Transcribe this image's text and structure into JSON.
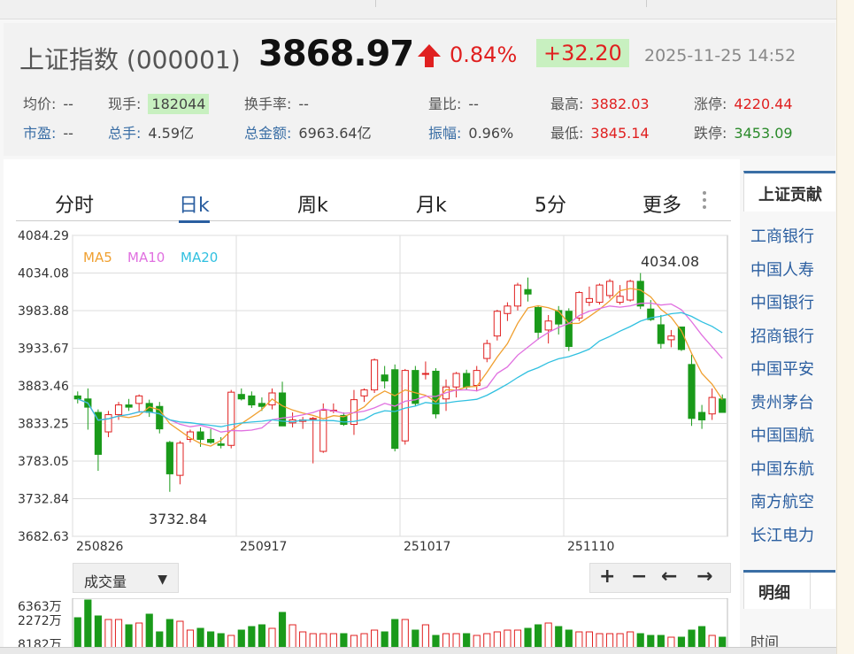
{
  "quote": {
    "name": "上证指数 (000001)",
    "price": "3868.97",
    "change_pct": "0.84%",
    "change": "+32.20",
    "time": "2025-11-25 14:52",
    "colors": {
      "up": "#e02020",
      "down": "#1a9a1a",
      "highlight_bg": "#c8f0c0"
    }
  },
  "stats": {
    "avg_label": "均价:",
    "avg_value": "--",
    "cur_label": "现手:",
    "cur_value": "182044",
    "turnover_label": "换手率:",
    "turnover_value": "--",
    "volratio_label": "量比:",
    "volratio_value": "--",
    "high_label": "最高:",
    "high_value": "3882.03",
    "limitup_label": "涨停:",
    "limitup_value": "4220.44",
    "pe_label": "市盈:",
    "pe_value": "--",
    "totalvol_label": "总手:",
    "totalvol_value": "4.59亿",
    "amount_label": "总金额:",
    "amount_value": "6963.64亿",
    "amp_label": "振幅:",
    "amp_value": "0.96%",
    "low_label": "最低:",
    "low_value": "3845.14",
    "limitdown_label": "跌停:",
    "limitdown_value": "3453.09"
  },
  "tabs": [
    {
      "label": "分时"
    },
    {
      "label": "日k"
    },
    {
      "label": "周k"
    },
    {
      "label": "月k"
    },
    {
      "label": "5分"
    },
    {
      "label": "更多"
    }
  ],
  "active_tab": "日k",
  "legend": {
    "ma5": "MA5",
    "ma10": "MA10",
    "ma20": "MA20",
    "ma5_color": "#f0a030",
    "ma10_color": "#e070e0",
    "ma20_color": "#30c0e0"
  },
  "chart_data": {
    "type": "candlestick",
    "y_ticks": [
      "4084.29",
      "4034.08",
      "3983.88",
      "3933.67",
      "3883.46",
      "3833.25",
      "3783.05",
      "3732.84",
      "3682.63"
    ],
    "ylim": [
      3682.63,
      4084.29
    ],
    "x_ticks": [
      {
        "label": "250826",
        "index": 0
      },
      {
        "label": "250917",
        "index": 16
      },
      {
        "label": "251017",
        "index": 32
      },
      {
        "label": "251110",
        "index": 48
      }
    ],
    "annotations": {
      "high": "4034.08",
      "low": "3732.84"
    },
    "candles": [
      [
        3870,
        3876,
        3860,
        3866
      ],
      [
        3866,
        3880,
        3825,
        3855
      ],
      [
        3848,
        3852,
        3770,
        3792
      ],
      [
        3822,
        3850,
        3815,
        3845
      ],
      [
        3845,
        3862,
        3838,
        3858
      ],
      [
        3858,
        3866,
        3850,
        3855
      ],
      [
        3860,
        3872,
        3848,
        3870
      ],
      [
        3860,
        3865,
        3842,
        3848
      ],
      [
        3856,
        3862,
        3820,
        3826
      ],
      [
        3808,
        3810,
        3742,
        3766
      ],
      [
        3764,
        3810,
        3752,
        3807
      ],
      [
        3812,
        3825,
        3808,
        3822
      ],
      [
        3822,
        3828,
        3802,
        3812
      ],
      [
        3812,
        3826,
        3806,
        3808
      ],
      [
        3806,
        3815,
        3800,
        3804
      ],
      [
        3804,
        3878,
        3800,
        3875
      ],
      [
        3872,
        3880,
        3864,
        3866
      ],
      [
        3870,
        3876,
        3854,
        3858
      ],
      [
        3860,
        3868,
        3850,
        3856
      ],
      [
        3858,
        3880,
        3852,
        3874
      ],
      [
        3874,
        3889,
        3830,
        3830
      ],
      [
        3834,
        3848,
        3828,
        3838
      ],
      [
        3836,
        3842,
        3826,
        3838
      ],
      [
        3839,
        3842,
        3780,
        3840
      ],
      [
        3796,
        3860,
        3794,
        3851
      ],
      [
        3851,
        3860,
        3847,
        3851
      ],
      [
        3844,
        3848,
        3830,
        3832
      ],
      [
        3832,
        3878,
        3818,
        3865
      ],
      [
        3870,
        3880,
        3862,
        3878
      ],
      [
        3878,
        3920,
        3874,
        3918
      ],
      [
        3898,
        3910,
        3880,
        3890
      ],
      [
        3905,
        3912,
        3796,
        3800
      ],
      [
        3810,
        3906,
        3805,
        3904
      ],
      [
        3904,
        3910,
        3856,
        3860
      ],
      [
        3900,
        3916,
        3892,
        3900
      ],
      [
        3903,
        3907,
        3840,
        3846
      ],
      [
        3866,
        3892,
        3850,
        3882
      ],
      [
        3882,
        3902,
        3868,
        3900
      ],
      [
        3900,
        3905,
        3878,
        3882
      ],
      [
        3884,
        3910,
        3876,
        3904
      ],
      [
        3920,
        3945,
        3915,
        3940
      ],
      [
        3950,
        3985,
        3944,
        3983
      ],
      [
        3980,
        3995,
        3970,
        3990
      ],
      [
        3990,
        4021,
        3984,
        4018
      ],
      [
        4012,
        4028,
        3996,
        4006
      ],
      [
        3988,
        3991,
        3945,
        3955
      ],
      [
        3958,
        3978,
        3940,
        3970
      ],
      [
        3984,
        3990,
        3952,
        3966
      ],
      [
        3983,
        3987,
        3930,
        3936
      ],
      [
        3974,
        4010,
        3970,
        4008
      ],
      [
        3995,
        4016,
        3990,
        4000
      ],
      [
        3995,
        4020,
        3992,
        4018
      ],
      [
        4004,
        4026,
        4000,
        4023
      ],
      [
        3995,
        4018,
        3992,
        4003
      ],
      [
        3998,
        4025,
        3996,
        4023
      ],
      [
        4023,
        4034,
        3986,
        3990
      ],
      [
        3986,
        3998,
        3970,
        3972
      ],
      [
        3965,
        3978,
        3933,
        3940
      ],
      [
        3945,
        3958,
        3935,
        3950
      ],
      [
        3962,
        3962,
        3930,
        3932
      ],
      [
        3912,
        3925,
        3830,
        3840
      ],
      [
        3848,
        3858,
        3826,
        3838
      ],
      [
        3846,
        3880,
        3838,
        3868
      ],
      [
        3866,
        3872,
        3848,
        3848
      ]
    ]
  },
  "volume": {
    "select_label": "成交量",
    "axis_labels": [
      "6363万",
      "2272万",
      "8182万"
    ],
    "bars": [
      34,
      54,
      36,
      32,
      32,
      26,
      28,
      38,
      18,
      32,
      30,
      20,
      22,
      18,
      16,
      14,
      20,
      24,
      26,
      22,
      40,
      26,
      18,
      16,
      16,
      16,
      16,
      14,
      16,
      20,
      18,
      32,
      32,
      20,
      26,
      14,
      16,
      16,
      16,
      14,
      16,
      18,
      20,
      20,
      22,
      26,
      28,
      24,
      20,
      18,
      18,
      16,
      16,
      16,
      18,
      16,
      14,
      14,
      12,
      12,
      20,
      24,
      14,
      12
    ]
  },
  "nav": {
    "zoom_in": "+",
    "zoom_out": "−",
    "left": "←",
    "right": "→"
  },
  "sidebar": {
    "title": "上证贡献",
    "items": [
      "工商银行",
      "中国人寿",
      "中国银行",
      "招商银行",
      "中国平安",
      "贵州茅台",
      "中国国航",
      "中国东航",
      "南方航空",
      "长江电力"
    ]
  },
  "detail": {
    "tab": "明细",
    "sub": "时间"
  }
}
